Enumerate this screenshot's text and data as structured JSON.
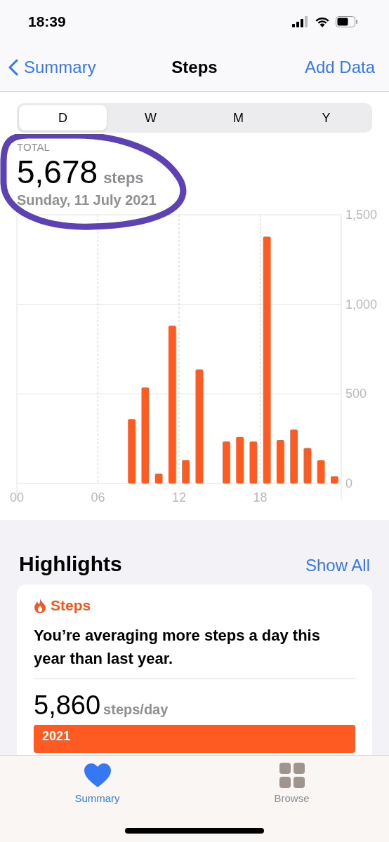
{
  "status_bar": {
    "time": "18:39"
  },
  "nav": {
    "back": "Summary",
    "title": "Steps",
    "action": "Add Data"
  },
  "segments": [
    {
      "label": "D",
      "selected": true
    },
    {
      "label": "W",
      "selected": false
    },
    {
      "label": "M",
      "selected": false
    },
    {
      "label": "Y",
      "selected": false
    }
  ],
  "summary": {
    "caption": "TOTAL",
    "value": "5,678",
    "unit": "steps",
    "date": "Sunday, 11 July 2021"
  },
  "chart_data": {
    "type": "bar",
    "grid": true,
    "x": [
      0.5,
      1.5,
      2.5,
      3.5,
      4.5,
      5.5,
      6.5,
      7.5,
      8.5,
      9.5,
      10.5,
      11.5,
      12.5,
      13.5,
      14.5,
      15.5,
      16.5,
      17.5,
      18.5,
      19.5,
      20.5,
      21.5,
      22.5,
      23.5
    ],
    "xlim": [
      0,
      24
    ],
    "series": [
      {
        "color": "#fd5b22",
        "values": [
          0,
          0,
          0,
          0,
          0,
          0,
          0,
          0,
          359,
          536,
          55,
          880,
          130,
          636,
          0,
          234,
          259,
          234,
          1378,
          243,
          301,
          198,
          129,
          40
        ]
      }
    ],
    "ylim": [
      0,
      1500
    ],
    "xticks": [
      {
        "value": 0,
        "label": "00"
      },
      {
        "value": 6,
        "label": "06"
      },
      {
        "value": 12,
        "label": "12"
      },
      {
        "value": 18,
        "label": "18"
      }
    ],
    "yticks": [
      {
        "value": 0,
        "label": "0"
      },
      {
        "value": 500,
        "label": "500"
      },
      {
        "value": 1000,
        "label": "1,000"
      },
      {
        "value": 1500,
        "label": "1,500"
      }
    ]
  },
  "highlights": {
    "title": "Highlights",
    "link": "Show All",
    "card": {
      "category": "Steps",
      "message": "You’re averaging more steps a day this year than last year.",
      "value": "5,860",
      "unit": "steps/day",
      "bar_label": "2021"
    }
  },
  "tab_bar": [
    {
      "label": "Summary",
      "selected": true,
      "kind": "heart"
    },
    {
      "label": "Browse",
      "selected": false,
      "kind": "grid"
    }
  ]
}
